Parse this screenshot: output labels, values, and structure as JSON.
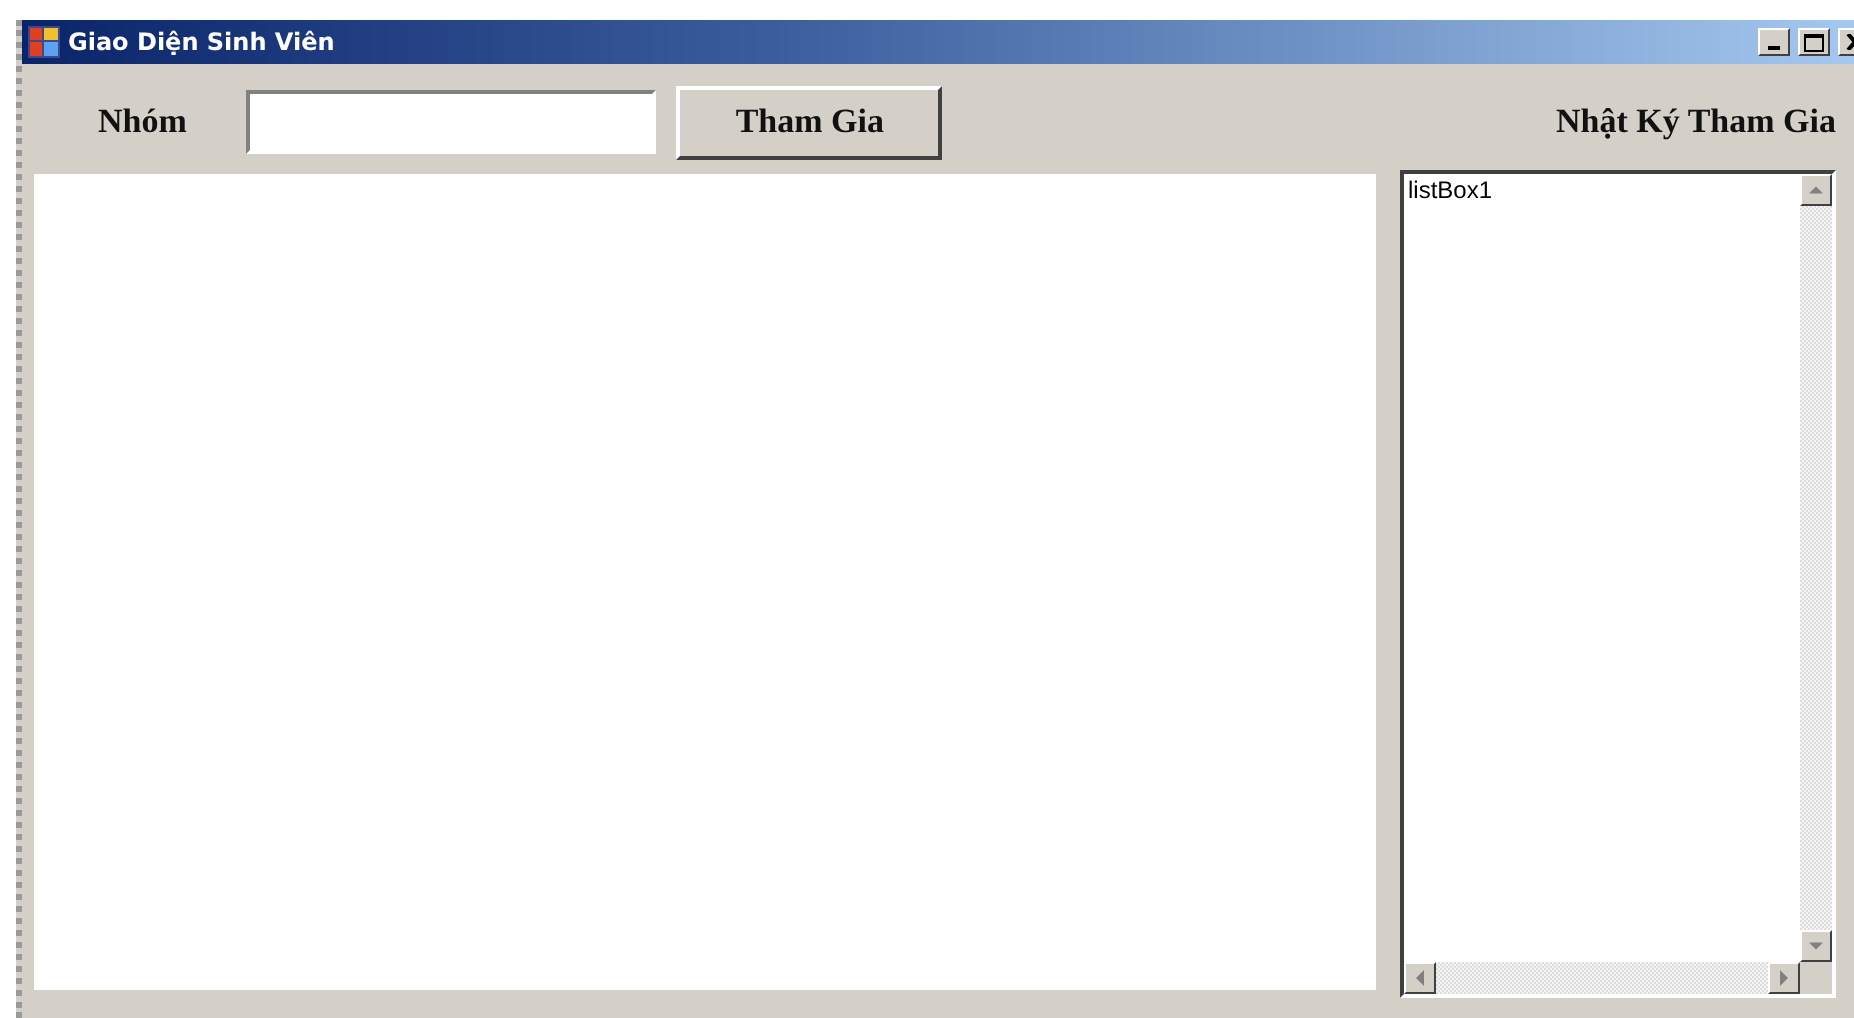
{
  "window": {
    "title": "Giao Diện Sinh Viên"
  },
  "group_label": "Nhóm",
  "join_button": "Tham Gia",
  "log_title": "Nhật Ký Tham Gia",
  "log_list": {
    "items": [
      "listBox1"
    ]
  }
}
